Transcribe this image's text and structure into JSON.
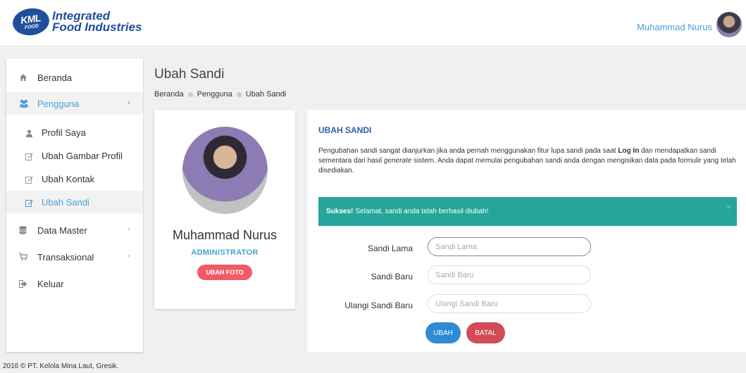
{
  "header": {
    "logo_mark_top": "KML",
    "logo_mark_bottom": "FOOD",
    "logo_line1": "Integrated",
    "logo_line2": "Food Industries",
    "user_name": "Muhammad Nurus"
  },
  "sidebar": {
    "items": [
      {
        "label": "Beranda",
        "icon": "home-icon"
      },
      {
        "label": "Pengguna",
        "icon": "users-icon",
        "chevron": "‹",
        "active": true
      },
      {
        "label": "Data Master",
        "icon": "database-icon",
        "chevron": "‹"
      },
      {
        "label": "Transaksional",
        "icon": "cart-icon",
        "chevron": "‹"
      },
      {
        "label": "Keluar",
        "icon": "logout-icon"
      }
    ],
    "subitems": [
      {
        "label": "Profil Saya",
        "icon": "user-icon"
      },
      {
        "label": "Ubah Gambar Profil",
        "icon": "edit-icon"
      },
      {
        "label": "Ubah Kontak",
        "icon": "edit-icon"
      },
      {
        "label": "Ubah Sandi",
        "icon": "edit-icon",
        "active": true
      }
    ]
  },
  "page": {
    "title": "Ubah Sandi",
    "breadcrumb": [
      "Beranda",
      "Pengguna",
      "Ubah Sandi"
    ]
  },
  "profile": {
    "name": "Muhammad Nurus",
    "role": "ADMINISTRATOR",
    "change_photo_label": "UBAH FOTO"
  },
  "panel": {
    "title": "UBAH SANDI",
    "desc_part1": "Pengubahan sandi sangat dianjurkan jika anda pernah menggunakan fitur lupa sandi pada saat ",
    "desc_bold": "Log In",
    "desc_part2": " dan mendapatkan sandi sementara dari hasil ",
    "desc_italic": "generate",
    "desc_part3": " sistem. Anda dapat memulai pengubahan sandi anda dengan mengisikan data pada formulir yang telah disediakan.",
    "alert_strong": "Sukses!",
    "alert_text": "Selamat, sandi anda telah berhasil diubah!",
    "alert_close": "×",
    "fields": [
      {
        "label": "Sandi Lama",
        "placeholder": "Sandi Lama",
        "value": ""
      },
      {
        "label": "Sandi Baru",
        "placeholder": "Sandi Baru",
        "value": ""
      },
      {
        "label": "Ulangi Sandi Baru",
        "placeholder": "Ulangi Sandi Baru",
        "value": ""
      }
    ],
    "submit_label": "UBAH",
    "cancel_label": "BATAL"
  },
  "footer": {
    "text": "2016 © PT. Kelola Mina Laut, Gresik."
  },
  "colors": {
    "accent": "#4a9fd8",
    "brand": "#1f4e9c",
    "success": "#26a69a",
    "danger": "#ef5c66",
    "primary_button": "#2e8bd6"
  }
}
